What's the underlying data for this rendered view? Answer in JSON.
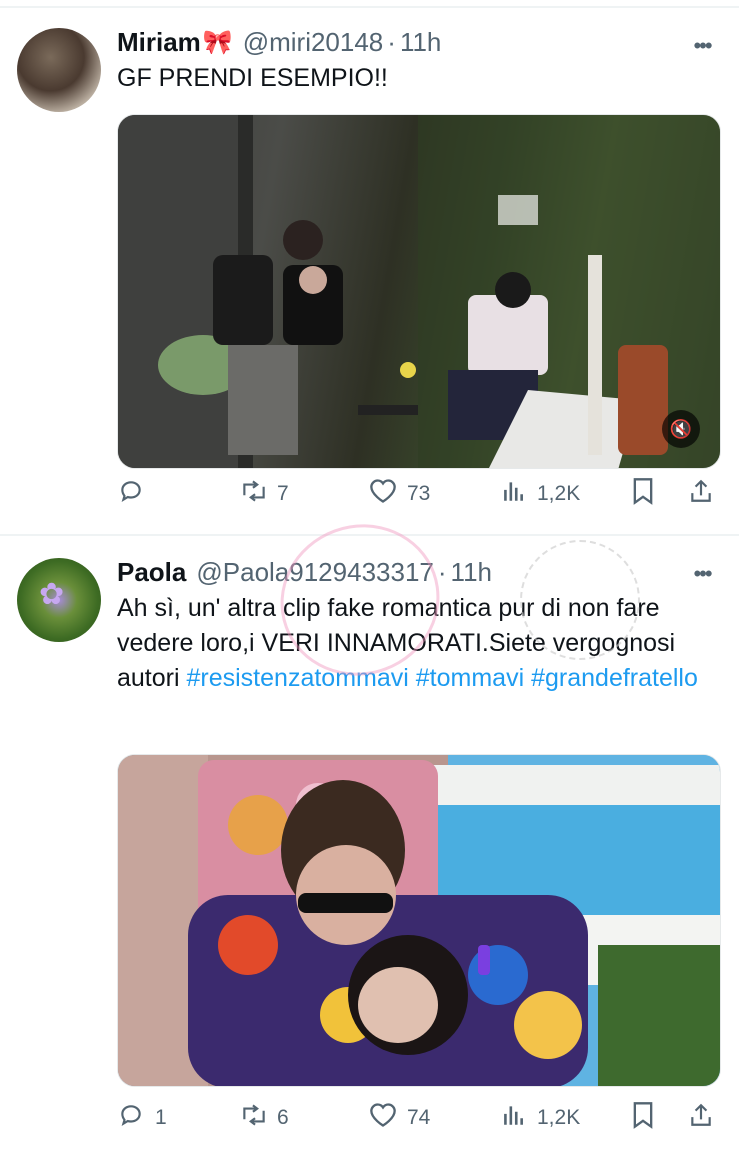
{
  "tweets": [
    {
      "name": "Miriam",
      "handle": "@miri20148",
      "separator": "·",
      "time": "11h",
      "text_plain": "GF PRENDI ESEMPIO!!",
      "hashtags": [],
      "media": {
        "kind": "video",
        "muted_icon": "mute-icon"
      },
      "actions": {
        "replies": "",
        "retweets": "7",
        "likes": "73",
        "views": "1,2K"
      }
    },
    {
      "name": "Paola",
      "handle": "@Paola9129433317",
      "separator": "·",
      "time": "11h",
      "text_plain": "Ah sì, un' altra clip fake romantica pur di non fare vedere loro,i VERI INNAMORATI.Siete vergognosi autori",
      "hashtags": [
        "#resistenzatommavi",
        "#tommavi",
        "#grandefratello"
      ],
      "media": {
        "kind": "image"
      },
      "actions": {
        "replies": "1",
        "retweets": "6",
        "likes": "74",
        "views": "1,2K"
      }
    }
  ],
  "icons": {
    "reply": "reply-icon",
    "retweet": "retweet-icon",
    "like": "heart-icon",
    "views": "views-icon",
    "bookmark": "bookmark-icon",
    "share": "share-icon",
    "more": "more-icon"
  },
  "colors": {
    "link": "#1d9bf0",
    "secondary_text": "#536471",
    "primary_text": "#0f1419"
  }
}
